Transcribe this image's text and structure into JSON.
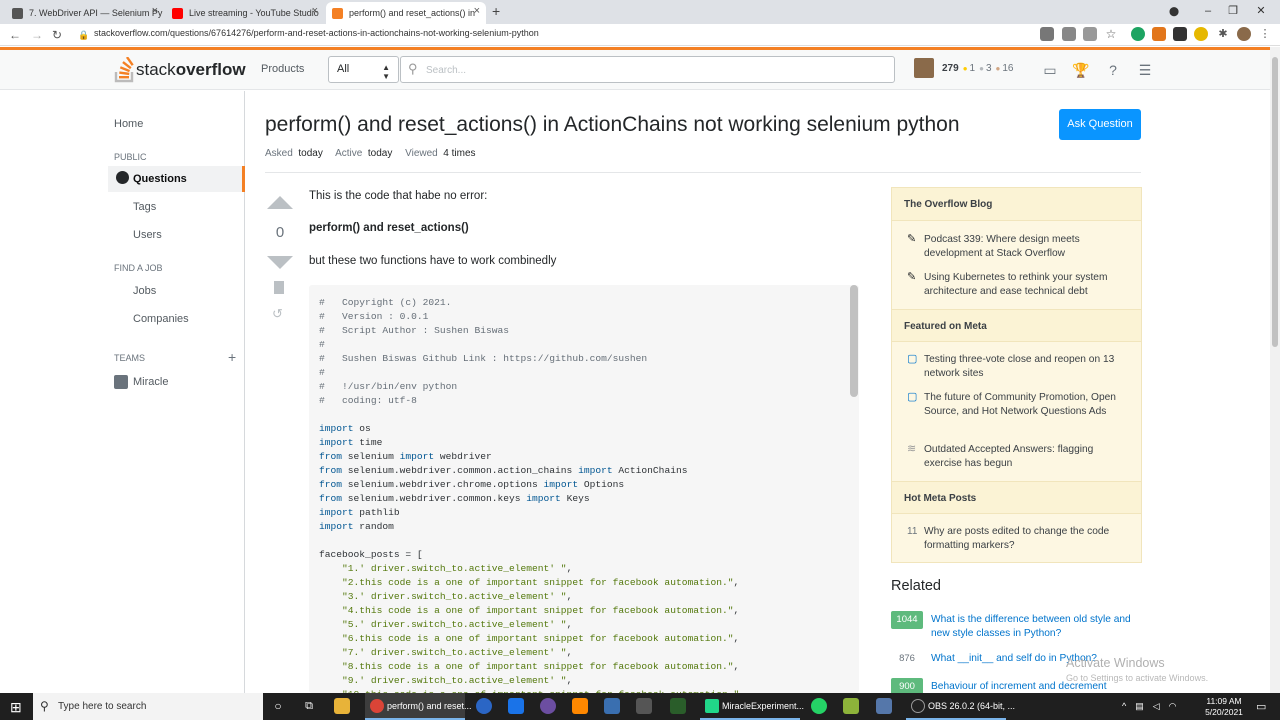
{
  "browser": {
    "tabs": [
      {
        "title": "7. WebDriver API — Selenium Py"
      },
      {
        "title": "Live streaming - YouTube Studio"
      },
      {
        "title": "perform() and reset_actions() in"
      }
    ],
    "url": "stackoverflow.com/questions/67614276/perform-and-reset-actions-in-actionchains-not-working-selenium-python",
    "new_tab": "+",
    "close_glyph": "×"
  },
  "so_header": {
    "logo_part1": "stack",
    "logo_part2": "overflow",
    "products": "Products",
    "search_scope": "All",
    "search_placeholder": "Search...",
    "reputation": "279",
    "badges": {
      "gold": "1",
      "silver": "3",
      "bronze": "16"
    },
    "badge_glyph": "●"
  },
  "left_nav": {
    "home": "Home",
    "public_label": "PUBLIC",
    "questions": "Questions",
    "tags": "Tags",
    "users": "Users",
    "find_job_label": "FIND A JOB",
    "jobs": "Jobs",
    "companies": "Companies",
    "teams_label": "TEAMS",
    "teams_add": "+",
    "team_name": "Miracle"
  },
  "question": {
    "title": "perform() and reset_actions() in ActionChains not working selenium python",
    "ask_button": "Ask Question",
    "asked_label": "Asked",
    "asked_value": "today",
    "active_label": "Active",
    "active_value": "today",
    "viewed_label": "Viewed",
    "viewed_value": "4 times",
    "votes": "0",
    "body_line1": "This is the code that habe no error:",
    "body_line2": "perform() and reset_actions()",
    "body_line3": "but these two functions have to work combinedly"
  },
  "code_lines": [
    {
      "parts": [
        {
          "t": "#   Copyright (c) 2021.",
          "c": "cm"
        }
      ]
    },
    {
      "parts": [
        {
          "t": "#   Version : 0.0.1",
          "c": "cm"
        }
      ]
    },
    {
      "parts": [
        {
          "t": "#   Script Author : Sushen Biswas",
          "c": "cm"
        }
      ]
    },
    {
      "parts": [
        {
          "t": "#",
          "c": "cm"
        }
      ]
    },
    {
      "parts": [
        {
          "t": "#   Sushen Biswas Github Link : https://github.com/sushen",
          "c": "cm"
        }
      ]
    },
    {
      "parts": [
        {
          "t": "#",
          "c": "cm"
        }
      ]
    },
    {
      "parts": [
        {
          "t": "#   !/usr/bin/env python",
          "c": "cm"
        }
      ]
    },
    {
      "parts": [
        {
          "t": "#   coding: utf-8",
          "c": "cm"
        }
      ]
    },
    {
      "parts": [
        {
          "t": "",
          "c": ""
        }
      ]
    },
    {
      "parts": [
        {
          "t": "import",
          "c": "kw"
        },
        {
          "t": " os",
          "c": ""
        }
      ]
    },
    {
      "parts": [
        {
          "t": "import",
          "c": "kw"
        },
        {
          "t": " time",
          "c": ""
        }
      ]
    },
    {
      "parts": [
        {
          "t": "from",
          "c": "kw"
        },
        {
          "t": " selenium ",
          "c": ""
        },
        {
          "t": "import",
          "c": "kw"
        },
        {
          "t": " webdriver",
          "c": ""
        }
      ]
    },
    {
      "parts": [
        {
          "t": "from",
          "c": "kw"
        },
        {
          "t": " selenium.webdriver.common.action_chains ",
          "c": ""
        },
        {
          "t": "import",
          "c": "kw"
        },
        {
          "t": " ActionChains",
          "c": ""
        }
      ]
    },
    {
      "parts": [
        {
          "t": "from",
          "c": "kw"
        },
        {
          "t": " selenium.webdriver.chrome.options ",
          "c": ""
        },
        {
          "t": "import",
          "c": "kw"
        },
        {
          "t": " Options",
          "c": ""
        }
      ]
    },
    {
      "parts": [
        {
          "t": "from",
          "c": "kw"
        },
        {
          "t": " selenium.webdriver.common.keys ",
          "c": ""
        },
        {
          "t": "import",
          "c": "kw"
        },
        {
          "t": " Keys",
          "c": ""
        }
      ]
    },
    {
      "parts": [
        {
          "t": "import",
          "c": "kw"
        },
        {
          "t": " pathlib",
          "c": ""
        }
      ]
    },
    {
      "parts": [
        {
          "t": "import",
          "c": "kw"
        },
        {
          "t": " random",
          "c": ""
        }
      ]
    },
    {
      "parts": [
        {
          "t": "",
          "c": ""
        }
      ]
    },
    {
      "parts": [
        {
          "t": "facebook_posts = [",
          "c": ""
        }
      ]
    },
    {
      "parts": [
        {
          "t": "    ",
          "c": ""
        },
        {
          "t": "\"1.' driver.switch_to.active_element' \"",
          "c": "st"
        },
        {
          "t": ",",
          "c": ""
        }
      ]
    },
    {
      "parts": [
        {
          "t": "    ",
          "c": ""
        },
        {
          "t": "\"2.this code is a one of important snippet for facebook automation.\"",
          "c": "st"
        },
        {
          "t": ",",
          "c": ""
        }
      ]
    },
    {
      "parts": [
        {
          "t": "    ",
          "c": ""
        },
        {
          "t": "\"3.' driver.switch_to.active_element' \"",
          "c": "st"
        },
        {
          "t": ",",
          "c": ""
        }
      ]
    },
    {
      "parts": [
        {
          "t": "    ",
          "c": ""
        },
        {
          "t": "\"4.this code is a one of important snippet for facebook automation.\"",
          "c": "st"
        },
        {
          "t": ",",
          "c": ""
        }
      ]
    },
    {
      "parts": [
        {
          "t": "    ",
          "c": ""
        },
        {
          "t": "\"5.' driver.switch_to.active_element' \"",
          "c": "st"
        },
        {
          "t": ",",
          "c": ""
        }
      ]
    },
    {
      "parts": [
        {
          "t": "    ",
          "c": ""
        },
        {
          "t": "\"6.this code is a one of important snippet for facebook automation.\"",
          "c": "st"
        },
        {
          "t": ",",
          "c": ""
        }
      ]
    },
    {
      "parts": [
        {
          "t": "    ",
          "c": ""
        },
        {
          "t": "\"7.' driver.switch_to.active_element' \"",
          "c": "st"
        },
        {
          "t": ",",
          "c": ""
        }
      ]
    },
    {
      "parts": [
        {
          "t": "    ",
          "c": ""
        },
        {
          "t": "\"8.this code is a one of important snippet for facebook automation.\"",
          "c": "st"
        },
        {
          "t": ",",
          "c": ""
        }
      ]
    },
    {
      "parts": [
        {
          "t": "    ",
          "c": ""
        },
        {
          "t": "\"9.' driver.switch_to.active_element' \"",
          "c": "st"
        },
        {
          "t": ",",
          "c": ""
        }
      ]
    },
    {
      "parts": [
        {
          "t": "    ",
          "c": ""
        },
        {
          "t": "\"10.this code is a one of important snippet for facebook automation.\"",
          "c": "st"
        },
        {
          "t": ",",
          "c": ""
        }
      ]
    }
  ],
  "right_sidebar": {
    "blog_heading": "The Overflow Blog",
    "blog_items": [
      "Podcast 339: Where design meets development at Stack Overflow",
      "Using Kubernetes to rethink your system architecture and ease technical debt"
    ],
    "meta_heading": "Featured on Meta",
    "meta_items": [
      "Testing three-vote close and reopen on 13 network sites",
      "The future of Community Promotion, Open Source, and Hot Network Questions Ads",
      "Outdated Accepted Answers: flagging exercise has begun"
    ],
    "hot_heading": "Hot Meta Posts",
    "hot_count": "11",
    "hot_item": "Why are posts edited to change the code formatting markers?"
  },
  "related": {
    "heading": "Related",
    "items": [
      {
        "score": "1044",
        "title": "What is the difference between old style and new style classes in Python?"
      },
      {
        "score": "876",
        "title": "What __init__ and self do in Python?"
      },
      {
        "score": "900",
        "title": "Behaviour of increment and decrement"
      }
    ]
  },
  "watermark": {
    "line1": "Activate Windows",
    "line2": "Go to Settings to activate Windows."
  },
  "taskbar": {
    "search_placeholder": "Type here to search",
    "app_chrome": "perform() and reset...",
    "app_miracle": "MiracleExperiment...",
    "app_obs": "OBS 26.0.2 (64-bit, ...",
    "time": "11:09 AM",
    "date": "5/20/2021"
  },
  "colors": {
    "accent": "#f48024",
    "link": "#0074cc",
    "button": "#0a95ff"
  }
}
